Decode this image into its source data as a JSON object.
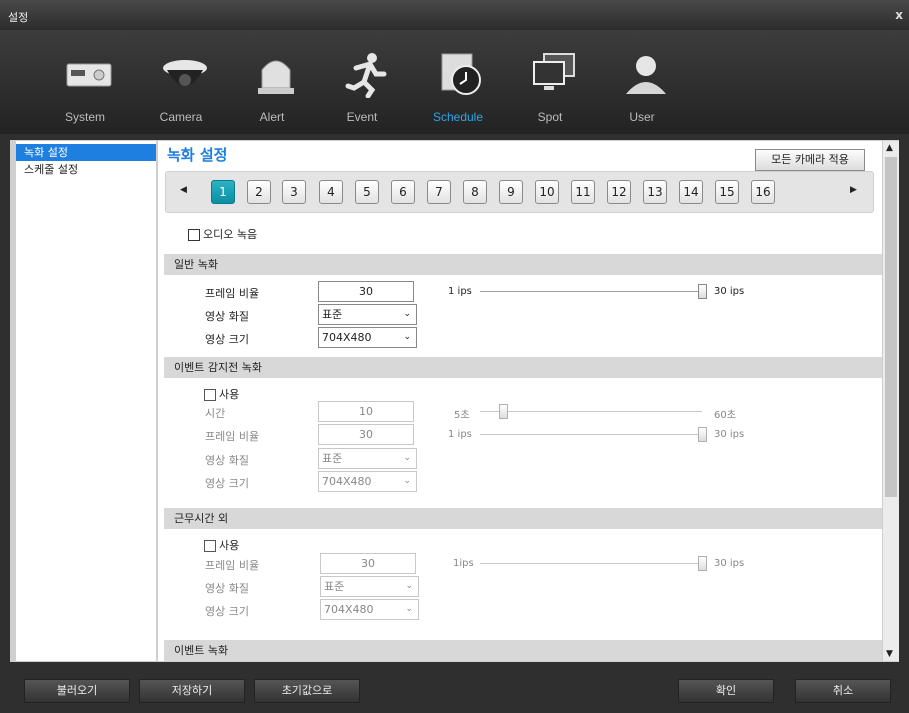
{
  "window": {
    "title": "설정",
    "close": "x"
  },
  "nav": [
    {
      "label": "System"
    },
    {
      "label": "Camera"
    },
    {
      "label": "Alert"
    },
    {
      "label": "Event"
    },
    {
      "label": "Schedule"
    },
    {
      "label": "Spot"
    },
    {
      "label": "User"
    }
  ],
  "sidebar": {
    "items": [
      {
        "label": "녹화 설정"
      },
      {
        "label": "스케줄 설정"
      }
    ]
  },
  "main": {
    "heading": "녹화 설정",
    "apply_all": "모든 카메라 적용",
    "channels": [
      "1",
      "2",
      "3",
      "4",
      "5",
      "6",
      "7",
      "8",
      "9",
      "10",
      "11",
      "12",
      "13",
      "14",
      "15",
      "16"
    ],
    "active_channel": "1",
    "audio_record": "오디오 녹음",
    "general": {
      "title": "일반 녹화",
      "frame_rate_label": "프레임 비율",
      "frame_rate": "30",
      "slider_min": "1 ips",
      "slider_max": "30 ips",
      "slider_value": 30,
      "quality_label": "영상 화질",
      "quality": "표준",
      "size_label": "영상 크기",
      "size": "704X480"
    },
    "pre_event": {
      "title": "이벤트 감지전 녹화",
      "use": "사용",
      "time_label": "시간",
      "time": "10",
      "time_min": "5초",
      "time_max": "60초",
      "frame_rate_label": "프레임 비율",
      "frame_rate": "30",
      "slider_min": "1 ips",
      "slider_max": "30 ips",
      "quality_label": "영상 화질",
      "quality": "표준",
      "size_label": "영상 크기",
      "size": "704X480"
    },
    "off_hours": {
      "title": "근무시간 외",
      "use": "사용",
      "frame_rate_label": "프레임 비율",
      "frame_rate": "30",
      "slider_min": "1ips",
      "slider_max": "30 ips",
      "quality_label": "영상 화질",
      "quality": "표준",
      "size_label": "영상 크기",
      "size": "704X480"
    },
    "event": {
      "title": "이벤트 녹화"
    }
  },
  "buttons": {
    "load": "불러오기",
    "save": "저장하기",
    "defaults": "초기값으로",
    "ok": "확인",
    "cancel": "취소"
  },
  "colors": {
    "accent": "#1e7fe0",
    "active_tab": "#29a6e8",
    "channel_active": "#0b8fa3"
  },
  "icons": [
    "monitor-icon",
    "camera-dome-icon",
    "alarm-light-icon",
    "running-person-icon",
    "clock-icon",
    "monitors-icon",
    "user-icon"
  ]
}
